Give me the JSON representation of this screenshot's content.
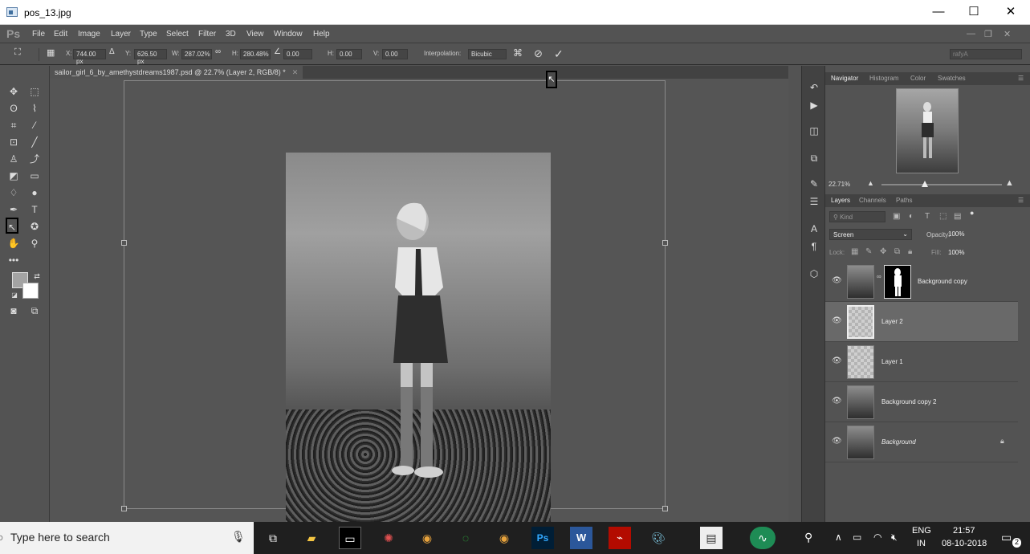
{
  "window": {
    "title": "pos_13.jpg",
    "minimize": "—",
    "maximize": "☐",
    "close": "✕"
  },
  "menubar": {
    "logo": "Ps",
    "items": [
      "File",
      "Edit",
      "Image",
      "Layer",
      "Type",
      "Select",
      "Filter",
      "3D",
      "View",
      "Window",
      "Help"
    ],
    "window_controls": [
      "—",
      "❐",
      "✕"
    ]
  },
  "options": {
    "x_label": "X:",
    "x_value": "744.00 px",
    "y_label": "Y:",
    "y_value": "626.50 px",
    "w_label": "W:",
    "w_value": "287.02%",
    "h_label": "H:",
    "h_value": "280.48%",
    "angle_value": "0.00",
    "hskew_label": "H:",
    "hskew_value": "0.00",
    "vskew_label": "V:",
    "vskew_value": "0.00",
    "interpolation_label": "Interpolation:",
    "interpolation_value": "Bicubic",
    "workspace": "rafyA"
  },
  "document": {
    "tab_title": "sailor_girl_6_by_amethystdreams1987.psd @ 22.7% (Layer 2, RGB/8) *"
  },
  "navigator": {
    "tabs": [
      "Navigator",
      "Histogram",
      "Color",
      "Swatches"
    ],
    "zoom": "22.71%"
  },
  "layers_panel": {
    "tabs": [
      "Layers",
      "Channels",
      "Paths"
    ],
    "filter_placeholder": "Kind",
    "blend_mode": "Screen",
    "opacity_label": "Opacity:",
    "opacity_value": "100%",
    "lock_label": "Lock:",
    "fill_label": "Fill:",
    "fill_value": "100%",
    "layers": [
      {
        "name": "Background copy",
        "has_mask": true,
        "selected": false
      },
      {
        "name": "Layer 2",
        "has_mask": false,
        "selected": true
      },
      {
        "name": "Layer 1",
        "has_mask": false,
        "selected": false
      },
      {
        "name": "Background copy 2",
        "has_mask": false,
        "selected": false
      },
      {
        "name": "Background",
        "has_mask": false,
        "selected": false,
        "locked": true
      }
    ]
  },
  "taskbar": {
    "search_placeholder": "Type here to search",
    "lang": "ENG",
    "region": "IN",
    "time": "21:57",
    "date": "08-10-2018",
    "notifications": "2"
  }
}
